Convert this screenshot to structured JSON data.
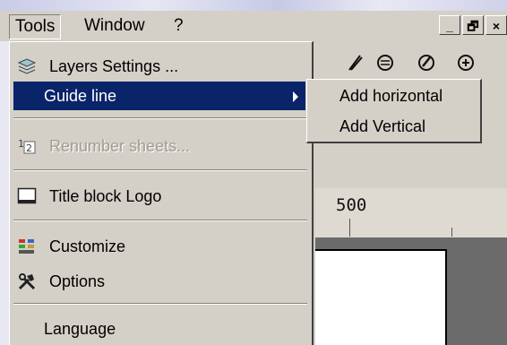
{
  "menubar": {
    "items": [
      {
        "label": "Tools",
        "active": true
      },
      {
        "label": "Window",
        "active": false
      },
      {
        "label": "?",
        "active": false
      }
    ],
    "window_controls": [
      "_",
      "🗗",
      "×"
    ]
  },
  "toolbar": {
    "icons": [
      "pencil-icon",
      "circle-tool-icon",
      "pen-circle-icon",
      "zoom-in-icon"
    ]
  },
  "tools_menu": {
    "items": [
      {
        "label": "Layers Settings ...",
        "icon": "layers-icon",
        "state": "normal"
      },
      {
        "label": "Guide line",
        "icon": "",
        "state": "highlighted",
        "has_submenu": true
      },
      {
        "label": "Renumber sheets...",
        "icon": "renumber-icon",
        "state": "disabled"
      },
      {
        "label": "Title block Logo",
        "icon": "title-block-icon",
        "state": "normal"
      },
      {
        "label": "Customize",
        "icon": "customize-icon",
        "state": "normal"
      },
      {
        "label": "Options",
        "icon": "options-icon",
        "state": "normal"
      },
      {
        "label": "Language",
        "icon": "",
        "state": "normal"
      }
    ]
  },
  "guide_line_submenu": {
    "items": [
      {
        "label": "Add horizontal"
      },
      {
        "label": "Add Vertical"
      }
    ]
  },
  "ruler": {
    "label": "500"
  },
  "colors": {
    "menu_bg": "#d4d0c8",
    "highlight": "#0a246a",
    "highlight_text": "#ffffff",
    "disabled_text": "#a09c94"
  }
}
